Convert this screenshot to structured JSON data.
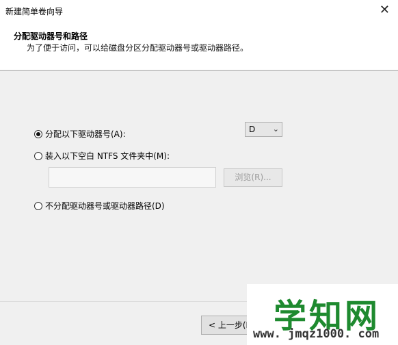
{
  "window": {
    "title": "新建简单卷向导",
    "close_glyph": "✕"
  },
  "header": {
    "title": "分配驱动器号和路径",
    "subtitle": "为了便于访问，可以给磁盘分区分配驱动器号或驱动器路径。"
  },
  "options": {
    "assign_letter": {
      "label": "分配以下驱动器号(A):",
      "selected": true
    },
    "mount_folder": {
      "label": "装入以下空白 NTFS 文件夹中(M):",
      "selected": false
    },
    "no_assign": {
      "label": "不分配驱动器号或驱动器路径(D)",
      "selected": false
    }
  },
  "drive_letter": {
    "value": "D",
    "chevron": "⌄"
  },
  "folder_path": {
    "value": "",
    "placeholder": ""
  },
  "browse_button": {
    "label": "浏览(R)..."
  },
  "footer": {
    "back_label": "< 上一步(B"
  },
  "watermark": {
    "text": "学知网",
    "url": "www. jmqz1000. com"
  }
}
